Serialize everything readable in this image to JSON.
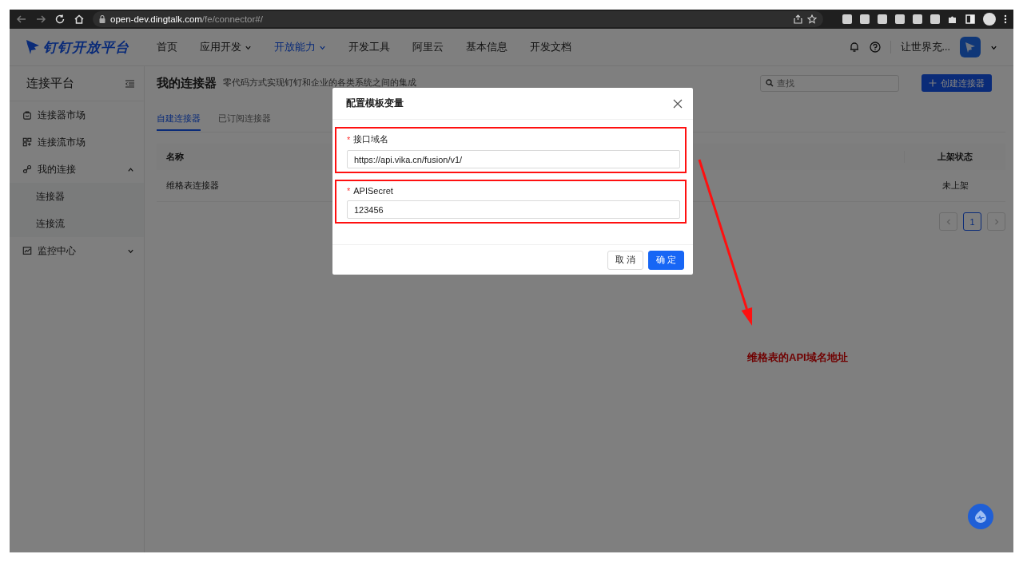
{
  "browser": {
    "url_host": "open-dev.dingtalk.com",
    "url_path": "/fe/connector#/"
  },
  "header": {
    "logo": "钉钉开放平台",
    "nav": [
      {
        "label": "首页",
        "dropdown": false,
        "selected": false
      },
      {
        "label": "应用开发",
        "dropdown": true,
        "selected": false
      },
      {
        "label": "开放能力",
        "dropdown": true,
        "selected": true
      },
      {
        "label": "开发工具",
        "dropdown": false,
        "selected": false
      },
      {
        "label": "阿里云",
        "dropdown": false,
        "selected": false
      },
      {
        "label": "基本信息",
        "dropdown": false,
        "selected": false
      },
      {
        "label": "开发文档",
        "dropdown": false,
        "selected": false
      }
    ],
    "user": "让世界充..."
  },
  "sidebar": {
    "title": "连接平台",
    "items": [
      {
        "label": "连接器市场"
      },
      {
        "label": "连接流市场"
      },
      {
        "label": "我的连接",
        "expanded": true,
        "children": [
          {
            "label": "连接器"
          },
          {
            "label": "连接流"
          }
        ]
      },
      {
        "label": "监控中心",
        "expanded": false
      }
    ]
  },
  "main": {
    "title": "我的连接器",
    "subtitle": "零代码方式实现钉钉和企业的各类系统之间的集成",
    "search": {
      "placeholder": "查找"
    },
    "create_button": "创建连接器",
    "tabs": [
      {
        "label": "自建连接器",
        "selected": true
      },
      {
        "label": "已订阅连接器",
        "selected": false
      }
    ],
    "table": {
      "columns": [
        "名称",
        "上架状态"
      ],
      "rows": [
        [
          "维格表连接器",
          "未上架"
        ]
      ]
    },
    "pagination": [
      {
        "label": "1",
        "selected": true
      }
    ]
  },
  "modal": {
    "title": "配置模板变量",
    "fields": [
      {
        "label": "接口域名",
        "required_mark": "*",
        "highlighted": true,
        "value": "https://api.vika.cn/fusion/v1/"
      },
      {
        "label": "APISecret",
        "required_mark": "*",
        "highlighted": true,
        "value": "123456"
      }
    ],
    "buttons": [
      {
        "label": "取 消",
        "kind": "secondary"
      },
      {
        "label": "确 定",
        "kind": "primary"
      }
    ]
  },
  "annotation": {
    "text": "维格表的API域名地址"
  }
}
